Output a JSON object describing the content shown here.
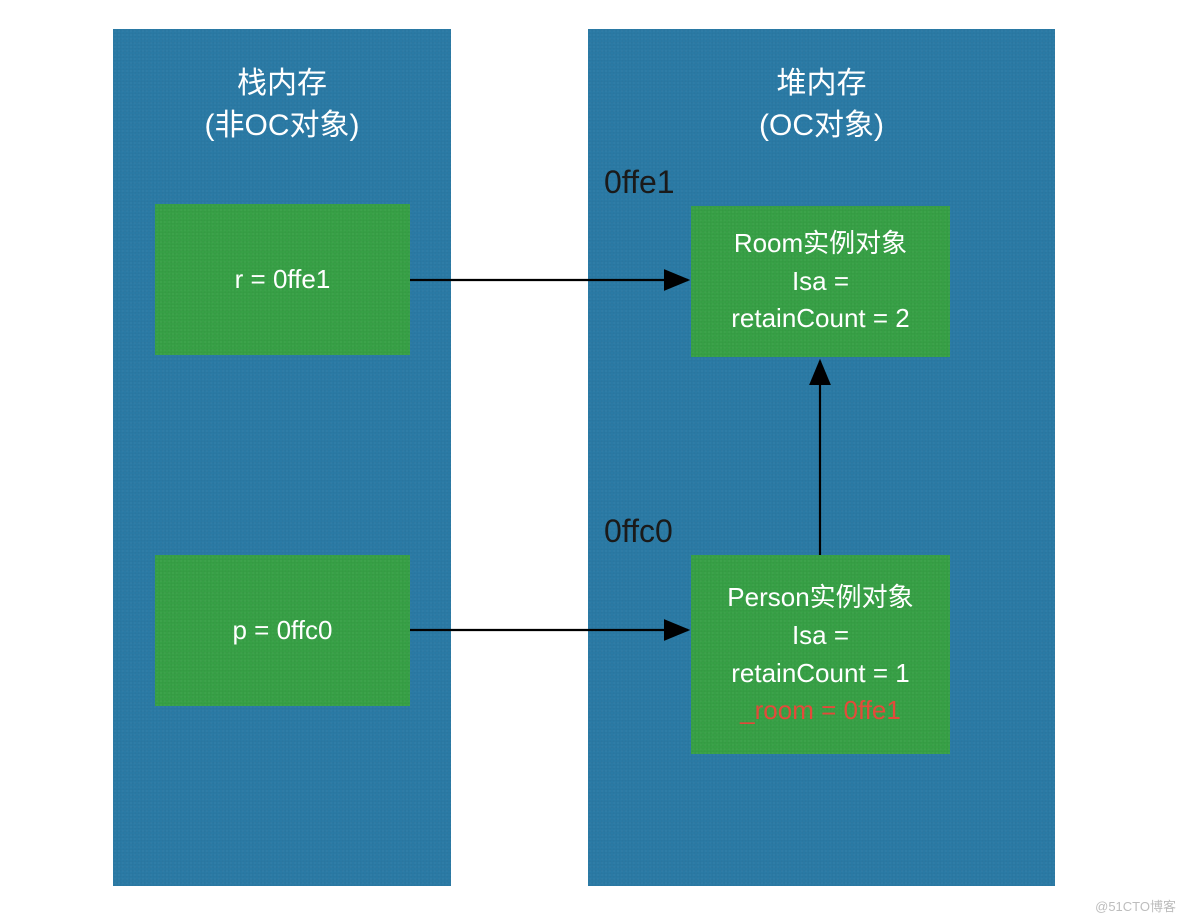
{
  "stack": {
    "title_line1": "栈内存",
    "title_line2": "(非OC对象)",
    "r_box": "r = 0ffe1",
    "p_box": "p = 0ffc0"
  },
  "heap": {
    "title_line1": "堆内存",
    "title_line2": "(OC对象)",
    "addr1": "0ffe1",
    "addr2": "0ffc0",
    "room": {
      "line1": "Room实例对象",
      "line2": "Isa =",
      "line3": "retainCount = 2"
    },
    "person": {
      "line1": "Person实例对象",
      "line2": "Isa =",
      "line3": "retainCount = 1",
      "line4": "_room = 0ffe1"
    }
  },
  "watermark": "@51CTO博客"
}
